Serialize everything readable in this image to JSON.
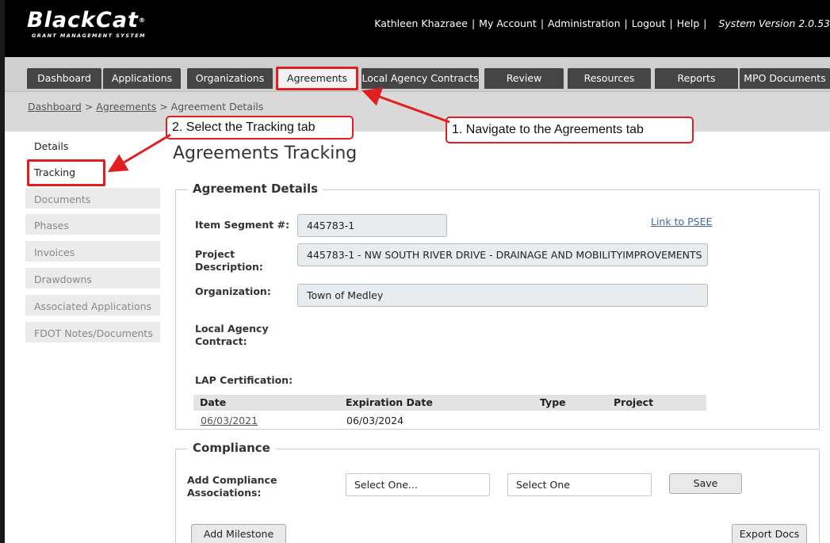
{
  "header": {
    "logo_text": "BlackCat",
    "logo_sub": "GRANT MANAGEMENT SYSTEM",
    "user_name": "Kathleen Khazraee",
    "links": [
      "My Account",
      "Administration",
      "Logout",
      "Help"
    ],
    "version": "System Version 2.0.53"
  },
  "tabs": [
    "Dashboard",
    "Applications",
    "Organizations",
    "Agreements",
    "Local Agency Contracts",
    "Review",
    "Resources",
    "Reports",
    "MPO Documents"
  ],
  "active_tab": "Agreements",
  "breadcrumb": {
    "items": [
      "Dashboard",
      "Agreements",
      "Agreement Details"
    ],
    "separator": ">"
  },
  "sidebar": {
    "items": [
      "Details",
      "Tracking",
      "Documents",
      "Phases",
      "Invoices",
      "Drawdowns",
      "Associated Applications",
      "FDOT Notes/Documents"
    ]
  },
  "page_title": "Agreements Tracking",
  "agreement_details": {
    "legend": "Agreement Details",
    "item_segment_label": "Item Segment #:",
    "item_segment_value": "445783-1",
    "link_psee": "Link to PSEE",
    "project_desc_label_1": "Project",
    "project_desc_label_2": "Description:",
    "project_desc_value": "445783-1 - NW SOUTH RIVER DRIVE - DRAINAGE AND MOBILITYIMPROVEMENTS",
    "organization_label": "Organization:",
    "organization_value": "Town of Medley",
    "lac_label_1": "Local Agency",
    "lac_label_2": "Contract:",
    "lap_label": "LAP Certification:",
    "lap_table": {
      "headers": [
        "Date",
        "Expiration Date",
        "Type",
        "Project"
      ],
      "rows": [
        [
          "06/03/2021",
          "06/03/2024",
          "",
          ""
        ]
      ]
    }
  },
  "compliance": {
    "legend": "Compliance",
    "add_label_1": "Add Compliance",
    "add_label_2": "Associations:",
    "select_1": "Select One...",
    "select_2": "Select One",
    "save_button": "Save",
    "add_milestone_button": "Add Milestone",
    "export_docs_button": "Export Docs"
  },
  "annotations": {
    "callout_1": "1. Navigate to the Agreements tab",
    "callout_2": "2. Select the Tracking tab",
    "color": "#e02020"
  }
}
